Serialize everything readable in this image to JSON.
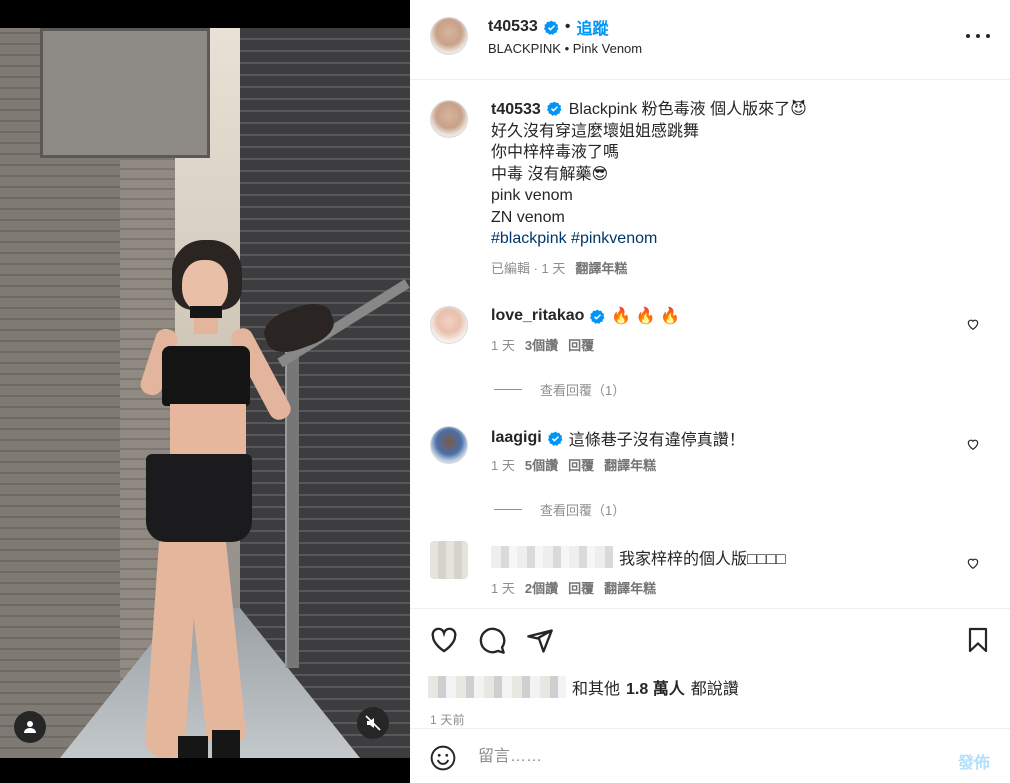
{
  "post": {
    "username": "t40533",
    "follow_label": "追蹤",
    "dot": "•",
    "subtitle": "BLACKPINK • Pink Venom"
  },
  "caption": {
    "username": "t40533",
    "lines": [
      "Blackpink 粉色毒液 個人版來了😈",
      "好久沒有穿這麼壞姐姐感跳舞",
      "你中梓梓毒液了嗎",
      "中毒 沒有解藥😎",
      "pink venom",
      "ZN venom"
    ],
    "hashtags": "#blackpink #pinkvenom",
    "edited": "已編輯 · 1 天",
    "translate": "翻譯年糕"
  },
  "comments": [
    {
      "username": "love_ritakao",
      "text": "🔥 🔥 🔥",
      "time": "1 天",
      "likes": "3個讚",
      "reply": "回覆",
      "translate": "",
      "view_replies": "查看回覆（1）"
    },
    {
      "username": "laagigi",
      "text": "這條巷子沒有違停真讚！",
      "time": "1 天",
      "likes": "5個讚",
      "reply": "回覆",
      "translate": "翻譯年糕",
      "view_replies": "查看回覆（1）"
    },
    {
      "username": "",
      "text": "我家梓梓的個人版□□□□",
      "time": "1 天",
      "likes": "2個讚",
      "reply": "回覆",
      "translate": "翻譯年糕",
      "view_replies": ""
    }
  ],
  "likes_summary": {
    "prefix": "和其他",
    "count": "1.8 萬人",
    "suffix": "都說讚"
  },
  "posted_ago": "1 天前",
  "composer": {
    "placeholder": "留言……",
    "post_label": "發佈"
  },
  "colors": {
    "accent": "#0095f6",
    "verified": "#0095f6",
    "post_disabled": "#b2dffc"
  },
  "icons": [
    "verified-badge-icon",
    "more-options-icon",
    "heart-icon",
    "comment-icon",
    "share-icon",
    "bookmark-icon",
    "emoji-icon",
    "user-tag-icon",
    "muted-speaker-icon"
  ]
}
